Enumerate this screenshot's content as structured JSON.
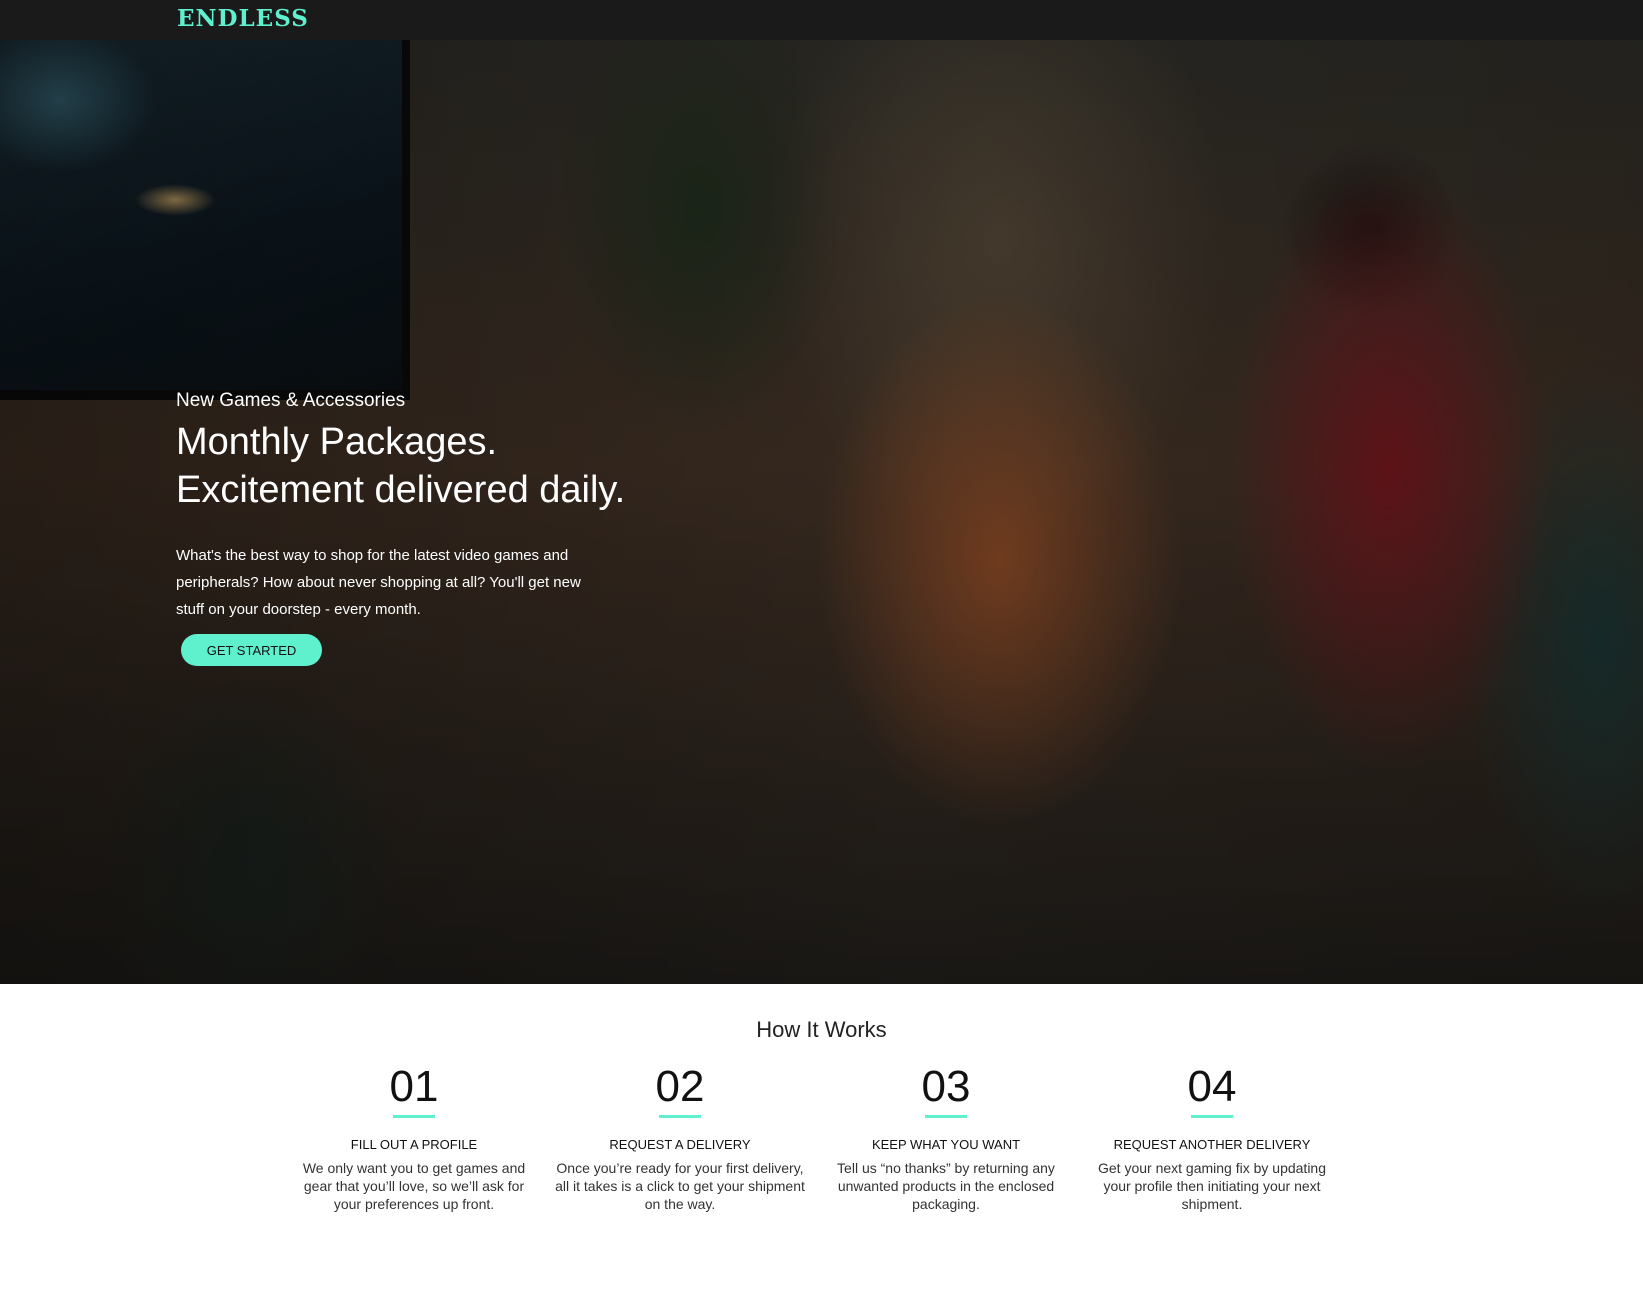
{
  "header": {
    "logo": "ENDLESS"
  },
  "hero": {
    "eyebrow": "New Games & Accessories",
    "heading_line1": "Monthly Packages.",
    "heading_line2": "Excitement delivered daily.",
    "text": "What's the best way to shop for the latest video games and peripherals? How about never shopping at all? You'll get new stuff on your doorstep - every month.",
    "cta_label": "GET STARTED"
  },
  "how": {
    "title": "How It Works",
    "steps": [
      {
        "number": "01",
        "title": "FILL OUT A PROFILE",
        "desc": "We only want you to get games and gear that you’ll love, so we’ll ask for your preferences up front."
      },
      {
        "number": "02",
        "title": "REQUEST A DELIVERY",
        "desc": "Once you’re ready for your first delivery, all it takes is a click to get your shipment on the way."
      },
      {
        "number": "03",
        "title": "KEEP WHAT YOU WANT",
        "desc": "Tell us “no thanks” by returning any unwanted products in the enclosed packaging."
      },
      {
        "number": "04",
        "title": "REQUEST ANOTHER DELIVERY",
        "desc": "Get your next gaming fix by updating your profile then initiating your next shipment."
      }
    ]
  },
  "colors": {
    "accent": "#5ff0cd",
    "topbar": "#1a1a1a"
  }
}
